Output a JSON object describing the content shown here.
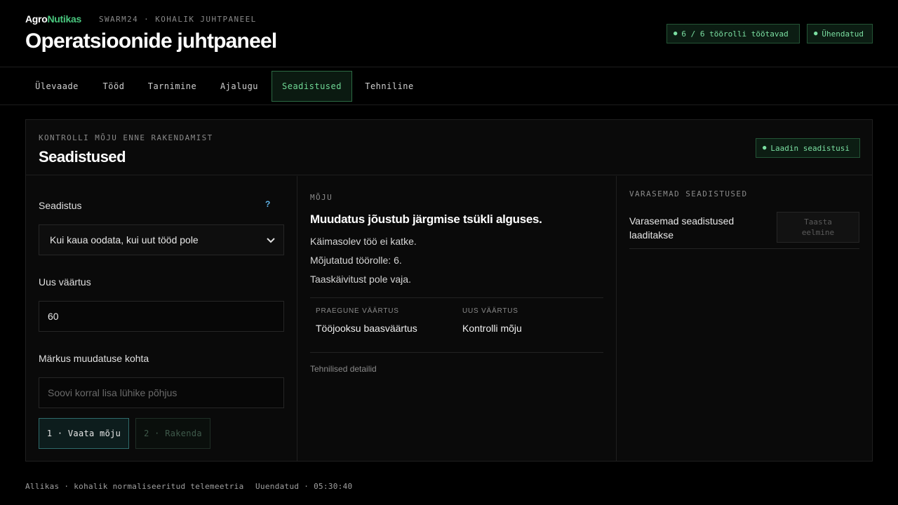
{
  "header": {
    "brand_part1": "Agro",
    "brand_part2": "Nutikas",
    "subtitle": "SWARM24 · KOHALIK JUHTPANEEL",
    "title": "Operatsioonide juhtpaneel",
    "badges": {
      "workers": "6 / 6 töörolli töötavad",
      "connection": "Ühendatud"
    }
  },
  "tabs": [
    {
      "label": "Ülevaade"
    },
    {
      "label": "Tööd"
    },
    {
      "label": "Tarnimine"
    },
    {
      "label": "Ajalugu"
    },
    {
      "label": "Seadistused",
      "active": true
    },
    {
      "label": "Tehniline"
    }
  ],
  "panel": {
    "eyebrow": "KONTROLLI MÕJU ENNE RAKENDAMIST",
    "title": "Seadistused",
    "loading_badge": "Laadin seadistusi",
    "form": {
      "setting_label": "Seadistus",
      "help": "?",
      "setting_value": "Kui kaua oodata, kui uut tööd pole",
      "new_value_label": "Uus väärtus",
      "new_value": "60",
      "note_label": "Märkus muudatuse kohta",
      "note_placeholder": "Soovi korral lisa lühike põhjus",
      "view_button": "1 · Vaata mõju",
      "apply_button": "2 · Rakenda"
    },
    "impact": {
      "eyebrow": "MÕJU",
      "title": "Muudatus jõustub järgmise tsükli alguses.",
      "lines": [
        "Käimasolev töö ei katke.",
        "Mõjutatud töörolle: 6.",
        "Taaskäivitust pole vaja."
      ],
      "current_label": "PRAEGUNE VÄÄRTUS",
      "current_value": "Tööjooksu baasväärtus",
      "new_label": "UUS VÄÄRTUS",
      "new_value": "Kontrolli mõju",
      "tech_details": "Tehnilised detailid"
    },
    "history": {
      "eyebrow": "VARASEMAD SEADISTUSED",
      "text": "Varasemad seadistused laaditakse",
      "restore_button_line1": "Taasta",
      "restore_button_line2": "eelmine"
    }
  },
  "footer": {
    "source": "Allikas · kohalik normaliseeritud telemeetria",
    "updated": "Uuendatud · 05:30:40"
  },
  "colors": {
    "accent_green": "#49c77e",
    "badge_text": "#7be0a2",
    "help_blue": "#5fb4e8",
    "background": "#000000"
  }
}
